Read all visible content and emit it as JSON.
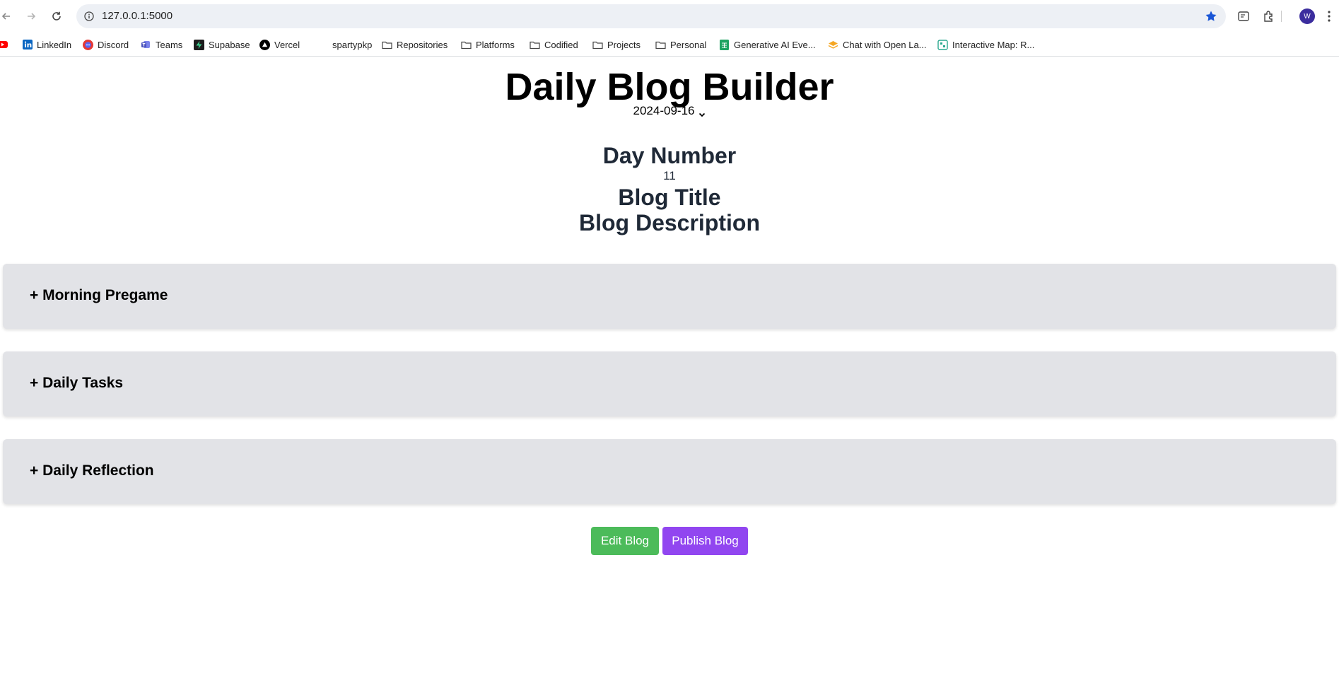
{
  "browser": {
    "url": "127.0.0.1:5000",
    "profile_initial": "W",
    "bookmarks": [
      {
        "label": "",
        "icon": "youtube-icon"
      },
      {
        "label": "LinkedIn",
        "icon": "linkedin-icon"
      },
      {
        "label": "Discord",
        "icon": "discord-icon"
      },
      {
        "label": "Teams",
        "icon": "teams-icon"
      },
      {
        "label": "Supabase",
        "icon": "supabase-icon"
      },
      {
        "label": "Vercel",
        "icon": "vercel-icon"
      },
      {
        "label": "spartypkp",
        "icon": "blank-icon"
      },
      {
        "label": "Repositories",
        "icon": "folder-icon"
      },
      {
        "label": "Platforms",
        "icon": "folder-icon"
      },
      {
        "label": "Codified",
        "icon": "folder-icon"
      },
      {
        "label": "Projects",
        "icon": "folder-icon"
      },
      {
        "label": "Personal",
        "icon": "folder-icon"
      },
      {
        "label": "Generative AI Eve...",
        "icon": "sheets-icon"
      },
      {
        "label": "Chat with Open La...",
        "icon": "chat-icon"
      },
      {
        "label": "Interactive Map: R...",
        "icon": "map-icon"
      }
    ]
  },
  "page": {
    "title": "Daily Blog Builder",
    "date": "2024-09-16",
    "day_number_heading": "Day Number",
    "day_number_value": "11",
    "blog_title_heading": "Blog Title",
    "blog_description_heading": "Blog Description"
  },
  "sections": [
    {
      "label": "+ Morning Pregame"
    },
    {
      "label": "+ Daily Tasks"
    },
    {
      "label": "+ Daily Reflection"
    }
  ],
  "actions": {
    "edit_label": "Edit Blog",
    "publish_label": "Publish Blog"
  },
  "colors": {
    "edit_button": "#4cbb5a",
    "publish_button": "#9146f0",
    "section_bg": "#e2e3e7"
  }
}
